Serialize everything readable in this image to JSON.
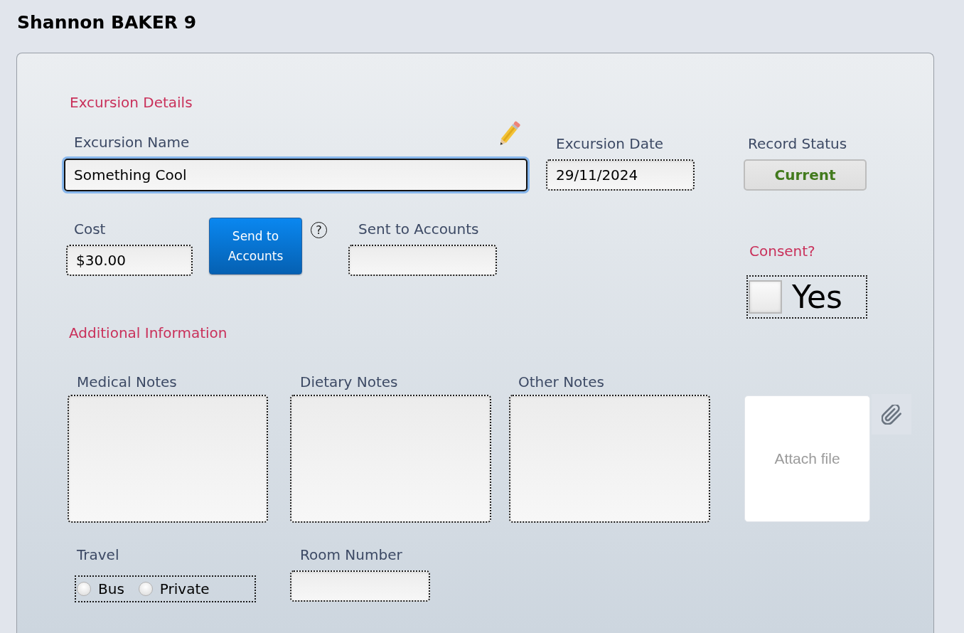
{
  "header": {
    "title": "Shannon BAKER 9"
  },
  "excursion_details": {
    "heading": "Excursion Details",
    "excursion_name": {
      "label": "Excursion Name",
      "value": "Something Cool",
      "focused": true
    },
    "excursion_date": {
      "label": "Excursion Date",
      "value": "29/11/2024"
    },
    "record_status": {
      "label": "Record Status",
      "value": "Current"
    },
    "cost": {
      "label": "Cost",
      "value": "$30.00"
    },
    "send_button": {
      "label": "Send to Accounts"
    },
    "help_button": {
      "label": "?"
    },
    "sent_to_accounts": {
      "label": "Sent to Accounts"
    },
    "consent": {
      "heading": "Consent?",
      "option": "Yes",
      "checked": false
    }
  },
  "additional_information": {
    "heading": "Additional Information",
    "notes": [
      {
        "label": "Medical Notes"
      },
      {
        "label": "Dietary Notes"
      },
      {
        "label": "Other Notes"
      }
    ],
    "attachment": {
      "label": "Attach file"
    },
    "travel": {
      "label": "Travel",
      "options": [
        {
          "label": "Bus",
          "selected": false
        },
        {
          "label": "Private",
          "selected": false
        }
      ]
    },
    "room_number": {
      "label": "Room Number"
    }
  }
}
